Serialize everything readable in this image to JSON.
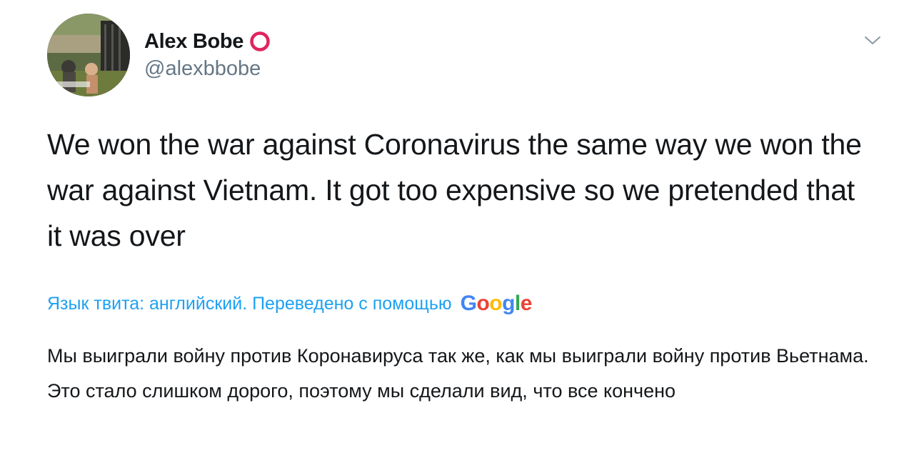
{
  "user": {
    "name": "Alex Bobe",
    "handle": "@alexbbobe",
    "avatar_icon": "profile-photo"
  },
  "menu": {
    "caret_icon": "chevron-down-icon"
  },
  "tweet": {
    "text": "We won the war against Coronavirus the same way we won the war against Vietnam. It got too expensive so we pretended that it was over"
  },
  "translation": {
    "label": "Язык твита: английский. Переведено с помощью",
    "provider_letters": [
      "G",
      "o",
      "o",
      "g",
      "l",
      "e"
    ],
    "provider_colors": [
      "#4285f4",
      "#ea4335",
      "#fbbc05",
      "#4285f4",
      "#34a853",
      "#ea4335"
    ],
    "text": "Мы выиграли войну против Коронавируса так же, как мы выиграли войну против Вьетнама. Это стало слишком дорого, поэтому мы сделали вид, что все кончено"
  },
  "colors": {
    "accent": "#1da1f2",
    "secondary_text": "#657786",
    "ring": "#e0245e"
  }
}
